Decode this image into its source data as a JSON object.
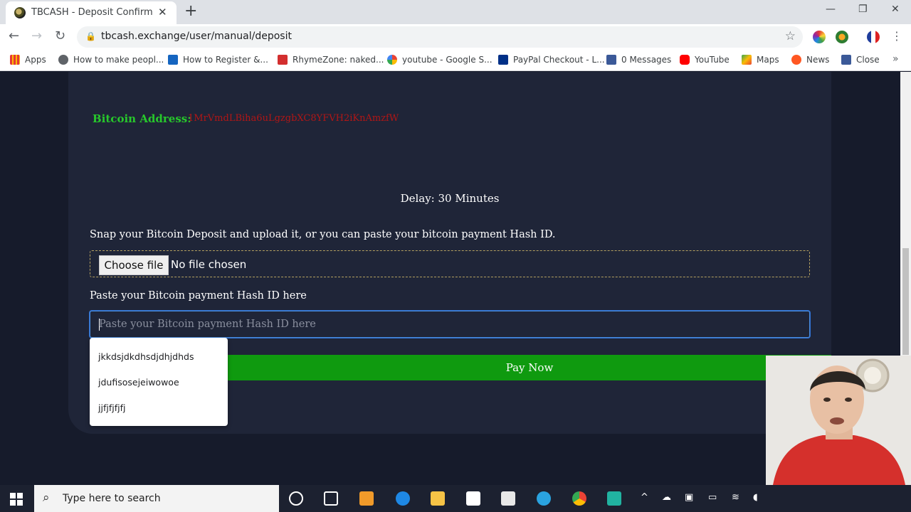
{
  "browser": {
    "tab_title": "TBCASH - Deposit Confirm",
    "tab_close": "✕",
    "new_tab": "+",
    "url": "tbcash.exchange/user/manual/deposit",
    "window_controls": {
      "minimize": "—",
      "restore": "❐",
      "close": "✕"
    }
  },
  "bookmarks": [
    {
      "label": "Apps",
      "icon": "apps-grid-icon",
      "color": "#1a73e8"
    },
    {
      "label": "How to make peopl...",
      "icon": "globe-icon",
      "color": "#5f6368"
    },
    {
      "label": "How to Register &...",
      "icon": "s-logo-icon",
      "color": "#1565c0"
    },
    {
      "label": "RhymeZone: naked...",
      "icon": "rhymezone-icon",
      "color": "#d32f2f"
    },
    {
      "label": "youtube - Google S...",
      "icon": "google-icon",
      "color": "#4285f4"
    },
    {
      "label": "PayPal Checkout - L...",
      "icon": "paypal-icon",
      "color": "#003087"
    },
    {
      "label": "0 Messages",
      "icon": "facebook-icon",
      "color": "#3b5998"
    },
    {
      "label": "YouTube",
      "icon": "youtube-icon",
      "color": "#ff0000"
    },
    {
      "label": "Maps",
      "icon": "maps-icon",
      "color": "#34a853"
    },
    {
      "label": "News",
      "icon": "news-icon",
      "color": "#ff5722"
    },
    {
      "label": "Close",
      "icon": "facebook-icon",
      "color": "#3b5998"
    }
  ],
  "page": {
    "bitcoin_label": "Bitcoin Address:",
    "bitcoin_value": "1MrVmdLBiha6uLgzgbXC8YFVH2iKnAmzfW",
    "delay": "Delay: 30 Minutes",
    "snap_text": "Snap your Bitcoin Deposit and upload it, or you can paste your bitcoin payment Hash ID.",
    "choose_file": "Choose file",
    "no_file": "No file chosen",
    "hash_label": "Paste your Bitcoin payment Hash ID here",
    "hash_placeholder": "Paste your Bitcoin payment Hash ID here",
    "pay_button": "Pay Now",
    "autocomplete": [
      "jkkdsjdkdhsdjdhjdhds",
      "jdufisosejeiwowoe",
      "jjfjfjfjfj"
    ]
  },
  "taskbar": {
    "search_placeholder": "Type here to search"
  },
  "colors": {
    "page_bg": "#161b2b",
    "card_bg": "#1f2538",
    "label_green": "#27c82b",
    "address_red": "#b21616",
    "pay_green": "#0f9a0f"
  }
}
